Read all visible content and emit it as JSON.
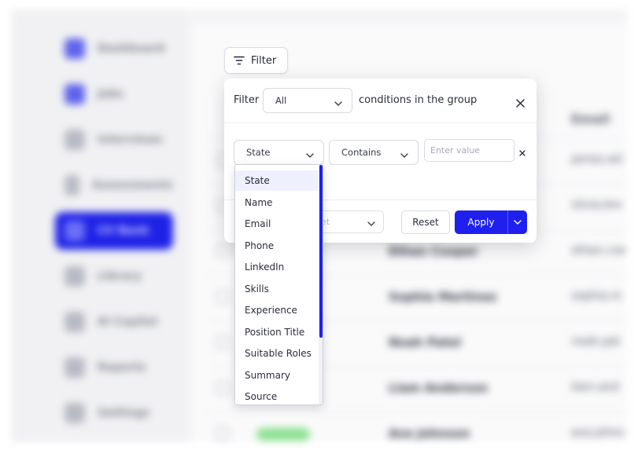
{
  "filter_button": {
    "label": "Filter"
  },
  "panel": {
    "prefix": "Filter",
    "match_select": "All",
    "suffix": "conditions in the group",
    "field_select": "State",
    "operator_select": "Contains",
    "value_placeholder": "Enter value",
    "footer_select": "et",
    "reset_label": "Reset",
    "apply_label": "Apply"
  },
  "dropdown": {
    "options": [
      "State",
      "Name",
      "Email",
      "Phone",
      "LinkedIn",
      "Skills",
      "Experience",
      "Position Title",
      "Suitable Roles",
      "Summary",
      "Source"
    ],
    "selected": "State"
  },
  "background": {
    "nav": [
      "Dashboard",
      "Jobs",
      "Interviews",
      "Assessments",
      "CV Bank",
      "Library",
      "AI Copilot",
      "Reports",
      "Settings"
    ],
    "active_nav": "CV Bank",
    "column_header": "Email",
    "rows": [
      {
        "name": "",
        "email": "james.wil"
      },
      {
        "name": "",
        "email": "olivia.bro"
      },
      {
        "name": "Ethan Cooper",
        "email": "ethan.coo"
      },
      {
        "name": "Sophia Martinez",
        "email": "sophia.m"
      },
      {
        "name": "Noah Patel",
        "email": "noah.pat"
      },
      {
        "name": "Liam Anderson",
        "email": "liam.and"
      },
      {
        "name": "Ava Johnson",
        "email": "ava.johns"
      }
    ]
  },
  "colors": {
    "accent": "#1f20ee",
    "selected_option_bg": "#eef1fd"
  },
  "icons": [
    "filter-lines-icon",
    "chevron-down-icon",
    "close-icon"
  ]
}
